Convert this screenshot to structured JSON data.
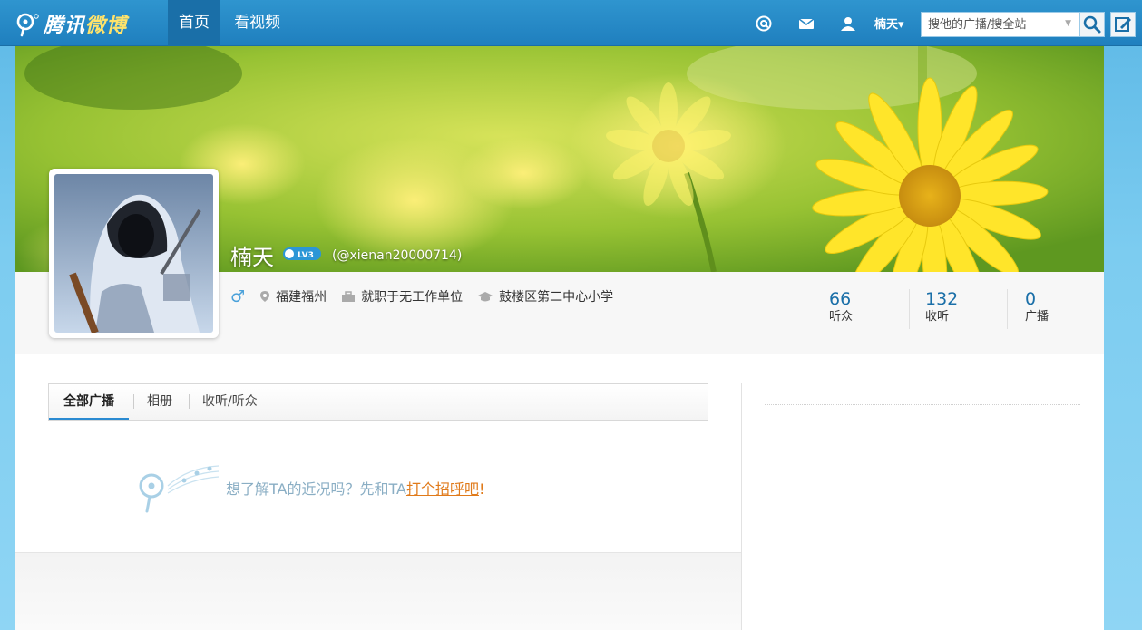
{
  "topbar": {
    "logo_text_a": "腾讯",
    "logo_text_b": "微博",
    "nav": [
      {
        "label": "首页",
        "active": true
      },
      {
        "label": "看视频",
        "active": false
      }
    ],
    "icons": [
      "at-icon",
      "mail-icon",
      "user-icon"
    ],
    "user_label": "楠天",
    "user_caret": "▾",
    "search": {
      "placeholder": "搜他的广播/搜全站"
    }
  },
  "profile": {
    "name": "楠天",
    "level": "LV3",
    "handle": "(@xienan20000714)",
    "gender": "♂",
    "location": "福建福州",
    "work": "就职于无工作单位",
    "school": "鼓楼区第二中心小学",
    "stats": [
      {
        "count": "66",
        "label": "听众"
      },
      {
        "count": "132",
        "label": "收听"
      },
      {
        "count": "0",
        "label": "广播"
      }
    ]
  },
  "tabs": [
    {
      "label": "全部广播",
      "active": true
    },
    {
      "label": "相册",
      "active": false
    },
    {
      "label": "收听/听众",
      "active": false
    }
  ],
  "empty_state": {
    "text": "想了解TA的近况吗？先和TA",
    "link": "打个招呼吧",
    "suffix": "!"
  },
  "colors": {
    "topbar": "#1f7fbe",
    "accent_link": "#e07a1a",
    "stat_number": "#1a6fa8"
  }
}
